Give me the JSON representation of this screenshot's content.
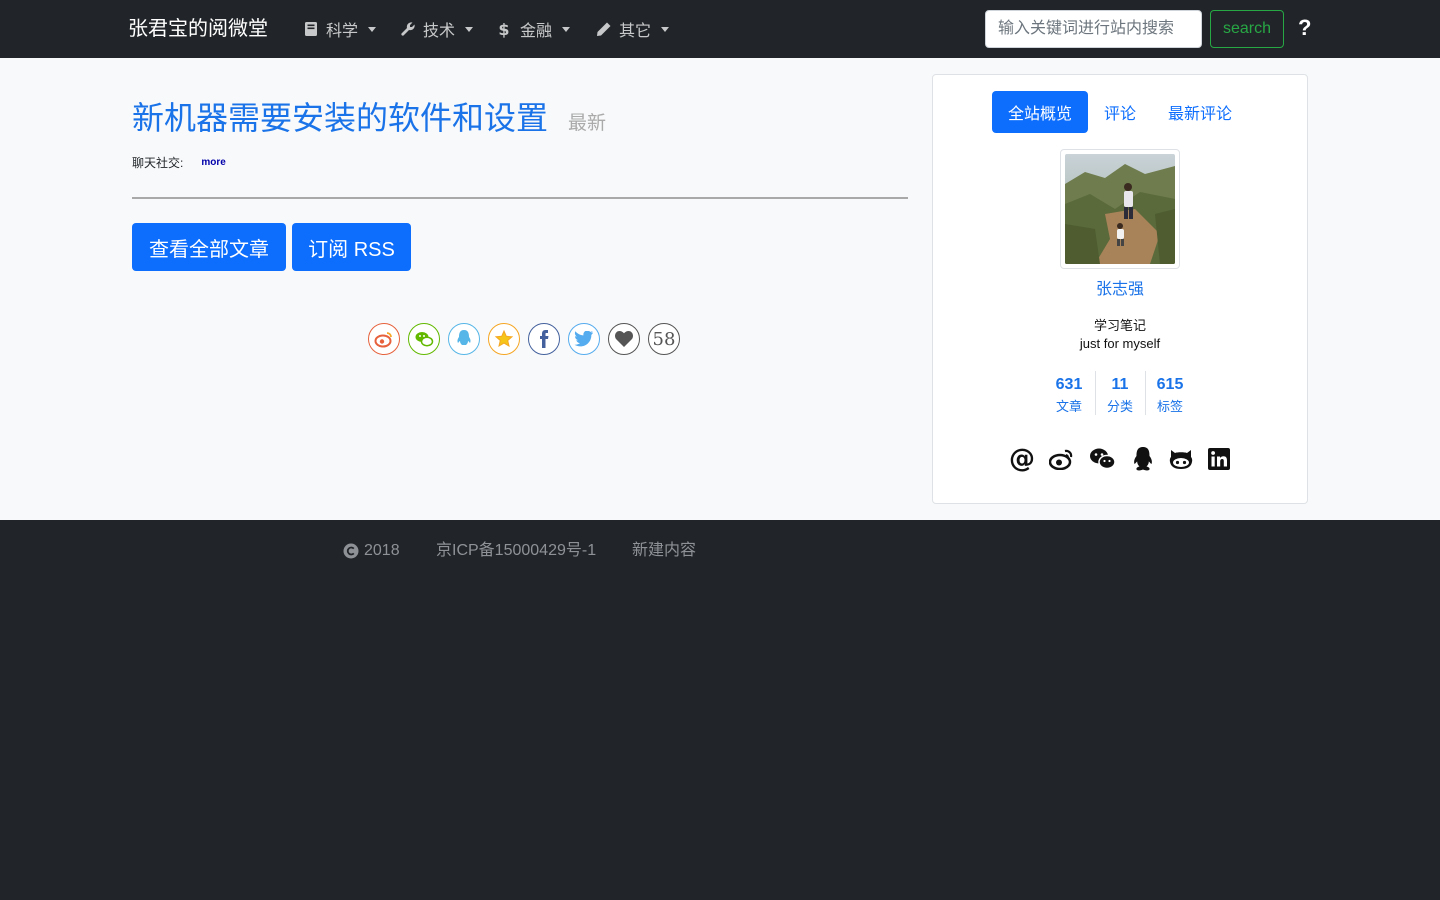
{
  "nav": {
    "brand": "张君宝的阅微堂",
    "items": [
      {
        "label": "科学",
        "icon": "book-icon"
      },
      {
        "label": "技术",
        "icon": "wrench-icon"
      },
      {
        "label": "金融",
        "icon": "dollar-icon"
      },
      {
        "label": "其它",
        "icon": "pencil-icon"
      }
    ],
    "search_placeholder": "输入关键词进行站内搜索",
    "search_label": "search",
    "help": "?"
  },
  "main": {
    "title": "新机器需要安装的软件和设置",
    "tag": "最新",
    "chat_label": "聊天社交:",
    "more": "more",
    "buttons": [
      "查看全部文章",
      "订阅 RSS"
    ],
    "share_icons": [
      "weibo-icon",
      "wechat-icon",
      "qq-icon",
      "qzone-star-icon",
      "facebook-icon",
      "twitter-icon",
      "like-heart-icon"
    ],
    "share_count": "58"
  },
  "sidebar": {
    "tabs": [
      "全站概览",
      "评论",
      "最新评论"
    ],
    "active_tab": "全站概览",
    "author": "张志强",
    "tagline": "学习笔记",
    "description": "just for myself",
    "stats": [
      {
        "num": "631",
        "label": "文章"
      },
      {
        "num": "11",
        "label": "分类"
      },
      {
        "num": "615",
        "label": "标签"
      }
    ],
    "social_icons": [
      "email-at-icon",
      "weibo-icon",
      "wechat-icon",
      "qq-icon",
      "github-icon",
      "linkedin-icon"
    ]
  },
  "footer": {
    "copyright": "2018",
    "icp": "京ICP备15000429号-1",
    "new_content": "新建内容"
  },
  "colors": {
    "primary": "#0d6efd",
    "link": "#1a73e8",
    "success": "#28a745",
    "dark": "#212529",
    "light_bg": "#f8f9fa"
  }
}
